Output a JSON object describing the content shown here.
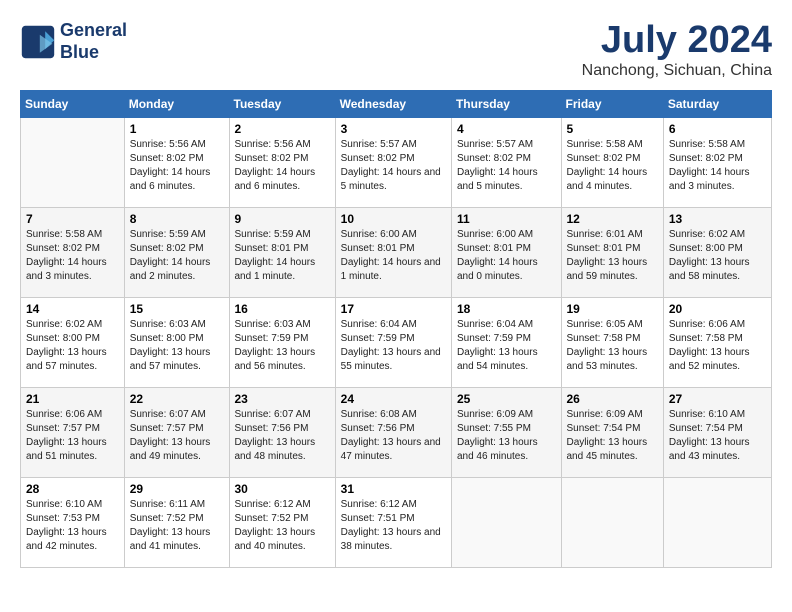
{
  "logo": {
    "line1": "General",
    "line2": "Blue"
  },
  "title": {
    "month_year": "July 2024",
    "location": "Nanchong, Sichuan, China"
  },
  "days_of_week": [
    "Sunday",
    "Monday",
    "Tuesday",
    "Wednesday",
    "Thursday",
    "Friday",
    "Saturday"
  ],
  "weeks": [
    [
      {
        "day": "",
        "sunrise": "",
        "sunset": "",
        "daylight": "",
        "empty": true
      },
      {
        "day": "1",
        "sunrise": "Sunrise: 5:56 AM",
        "sunset": "Sunset: 8:02 PM",
        "daylight": "Daylight: 14 hours and 6 minutes."
      },
      {
        "day": "2",
        "sunrise": "Sunrise: 5:56 AM",
        "sunset": "Sunset: 8:02 PM",
        "daylight": "Daylight: 14 hours and 6 minutes."
      },
      {
        "day": "3",
        "sunrise": "Sunrise: 5:57 AM",
        "sunset": "Sunset: 8:02 PM",
        "daylight": "Daylight: 14 hours and 5 minutes."
      },
      {
        "day": "4",
        "sunrise": "Sunrise: 5:57 AM",
        "sunset": "Sunset: 8:02 PM",
        "daylight": "Daylight: 14 hours and 5 minutes."
      },
      {
        "day": "5",
        "sunrise": "Sunrise: 5:58 AM",
        "sunset": "Sunset: 8:02 PM",
        "daylight": "Daylight: 14 hours and 4 minutes."
      },
      {
        "day": "6",
        "sunrise": "Sunrise: 5:58 AM",
        "sunset": "Sunset: 8:02 PM",
        "daylight": "Daylight: 14 hours and 3 minutes."
      }
    ],
    [
      {
        "day": "7",
        "sunrise": "Sunrise: 5:58 AM",
        "sunset": "Sunset: 8:02 PM",
        "daylight": "Daylight: 14 hours and 3 minutes."
      },
      {
        "day": "8",
        "sunrise": "Sunrise: 5:59 AM",
        "sunset": "Sunset: 8:02 PM",
        "daylight": "Daylight: 14 hours and 2 minutes."
      },
      {
        "day": "9",
        "sunrise": "Sunrise: 5:59 AM",
        "sunset": "Sunset: 8:01 PM",
        "daylight": "Daylight: 14 hours and 1 minute."
      },
      {
        "day": "10",
        "sunrise": "Sunrise: 6:00 AM",
        "sunset": "Sunset: 8:01 PM",
        "daylight": "Daylight: 14 hours and 1 minute."
      },
      {
        "day": "11",
        "sunrise": "Sunrise: 6:00 AM",
        "sunset": "Sunset: 8:01 PM",
        "daylight": "Daylight: 14 hours and 0 minutes."
      },
      {
        "day": "12",
        "sunrise": "Sunrise: 6:01 AM",
        "sunset": "Sunset: 8:01 PM",
        "daylight": "Daylight: 13 hours and 59 minutes."
      },
      {
        "day": "13",
        "sunrise": "Sunrise: 6:02 AM",
        "sunset": "Sunset: 8:00 PM",
        "daylight": "Daylight: 13 hours and 58 minutes."
      }
    ],
    [
      {
        "day": "14",
        "sunrise": "Sunrise: 6:02 AM",
        "sunset": "Sunset: 8:00 PM",
        "daylight": "Daylight: 13 hours and 57 minutes."
      },
      {
        "day": "15",
        "sunrise": "Sunrise: 6:03 AM",
        "sunset": "Sunset: 8:00 PM",
        "daylight": "Daylight: 13 hours and 57 minutes."
      },
      {
        "day": "16",
        "sunrise": "Sunrise: 6:03 AM",
        "sunset": "Sunset: 7:59 PM",
        "daylight": "Daylight: 13 hours and 56 minutes."
      },
      {
        "day": "17",
        "sunrise": "Sunrise: 6:04 AM",
        "sunset": "Sunset: 7:59 PM",
        "daylight": "Daylight: 13 hours and 55 minutes."
      },
      {
        "day": "18",
        "sunrise": "Sunrise: 6:04 AM",
        "sunset": "Sunset: 7:59 PM",
        "daylight": "Daylight: 13 hours and 54 minutes."
      },
      {
        "day": "19",
        "sunrise": "Sunrise: 6:05 AM",
        "sunset": "Sunset: 7:58 PM",
        "daylight": "Daylight: 13 hours and 53 minutes."
      },
      {
        "day": "20",
        "sunrise": "Sunrise: 6:06 AM",
        "sunset": "Sunset: 7:58 PM",
        "daylight": "Daylight: 13 hours and 52 minutes."
      }
    ],
    [
      {
        "day": "21",
        "sunrise": "Sunrise: 6:06 AM",
        "sunset": "Sunset: 7:57 PM",
        "daylight": "Daylight: 13 hours and 51 minutes."
      },
      {
        "day": "22",
        "sunrise": "Sunrise: 6:07 AM",
        "sunset": "Sunset: 7:57 PM",
        "daylight": "Daylight: 13 hours and 49 minutes."
      },
      {
        "day": "23",
        "sunrise": "Sunrise: 6:07 AM",
        "sunset": "Sunset: 7:56 PM",
        "daylight": "Daylight: 13 hours and 48 minutes."
      },
      {
        "day": "24",
        "sunrise": "Sunrise: 6:08 AM",
        "sunset": "Sunset: 7:56 PM",
        "daylight": "Daylight: 13 hours and 47 minutes."
      },
      {
        "day": "25",
        "sunrise": "Sunrise: 6:09 AM",
        "sunset": "Sunset: 7:55 PM",
        "daylight": "Daylight: 13 hours and 46 minutes."
      },
      {
        "day": "26",
        "sunrise": "Sunrise: 6:09 AM",
        "sunset": "Sunset: 7:54 PM",
        "daylight": "Daylight: 13 hours and 45 minutes."
      },
      {
        "day": "27",
        "sunrise": "Sunrise: 6:10 AM",
        "sunset": "Sunset: 7:54 PM",
        "daylight": "Daylight: 13 hours and 43 minutes."
      }
    ],
    [
      {
        "day": "28",
        "sunrise": "Sunrise: 6:10 AM",
        "sunset": "Sunset: 7:53 PM",
        "daylight": "Daylight: 13 hours and 42 minutes."
      },
      {
        "day": "29",
        "sunrise": "Sunrise: 6:11 AM",
        "sunset": "Sunset: 7:52 PM",
        "daylight": "Daylight: 13 hours and 41 minutes."
      },
      {
        "day": "30",
        "sunrise": "Sunrise: 6:12 AM",
        "sunset": "Sunset: 7:52 PM",
        "daylight": "Daylight: 13 hours and 40 minutes."
      },
      {
        "day": "31",
        "sunrise": "Sunrise: 6:12 AM",
        "sunset": "Sunset: 7:51 PM",
        "daylight": "Daylight: 13 hours and 38 minutes."
      },
      {
        "day": "",
        "empty": true
      },
      {
        "day": "",
        "empty": true
      },
      {
        "day": "",
        "empty": true
      }
    ]
  ]
}
